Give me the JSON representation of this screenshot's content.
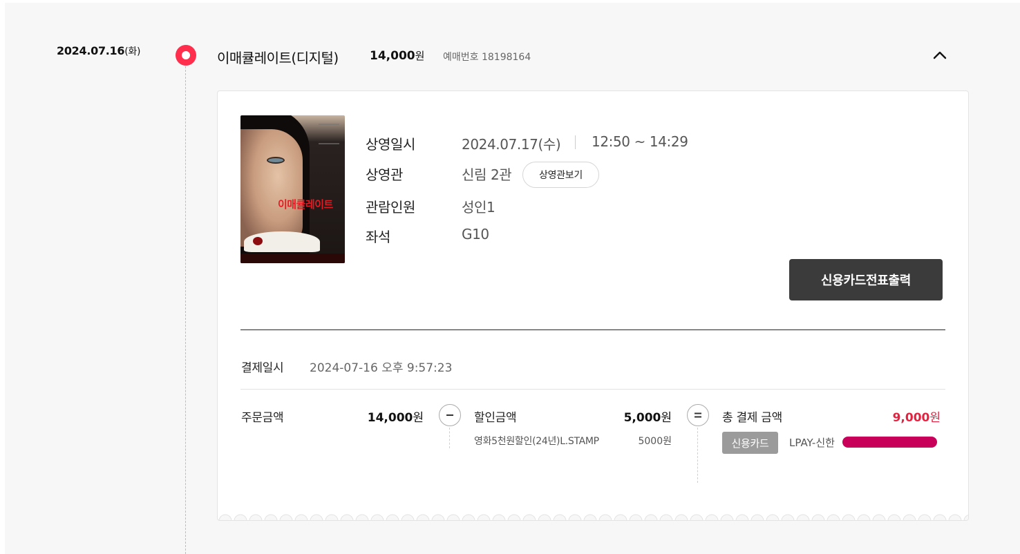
{
  "header": {
    "date": "2024.07.16",
    "day_of_week": "(화)",
    "movie_title": "이매큘레이트(디지털)",
    "price": "14,000",
    "price_unit": "원",
    "booking_label": "예매번호",
    "booking_number": "18198164"
  },
  "poster": {
    "title_text": "이매큘레이트"
  },
  "details": {
    "showtime_label": "상영일시",
    "showtime_date": "2024.07.17(수)",
    "showtime_time": "12:50 ~ 14:29",
    "theater_label": "상영관",
    "theater_value": "신림 2관",
    "theater_button": "상영관보기",
    "audience_label": "관람인원",
    "audience_value": "성인1",
    "seat_label": "좌석",
    "seat_value": "G10"
  },
  "receipt_button": "신용카드전표출력",
  "payment": {
    "date_label": "결제일시",
    "date_value": "2024-07-16 오후 9:57:23",
    "order_label": "주문금액",
    "order_amount": "14,000",
    "discount_label": "할인금액",
    "discount_amount": "5,000",
    "total_label": "총 결제 금액",
    "total_amount": "9,000",
    "unit": "원",
    "discount_item_name": "영화5천원할인(24년)L.STAMP",
    "discount_item_amount": "5000원",
    "method_badge": "신용카드",
    "card_info": "LPAY-신한"
  },
  "colors": {
    "accent": "#ff2e4c",
    "total_red": "#e8203f",
    "button_dark": "#3b3b3b",
    "redaction": "#c8005a"
  },
  "icons": {
    "collapse": "chevron-up-icon",
    "minus": "minus-circle-icon",
    "equals": "equals-circle-icon"
  }
}
